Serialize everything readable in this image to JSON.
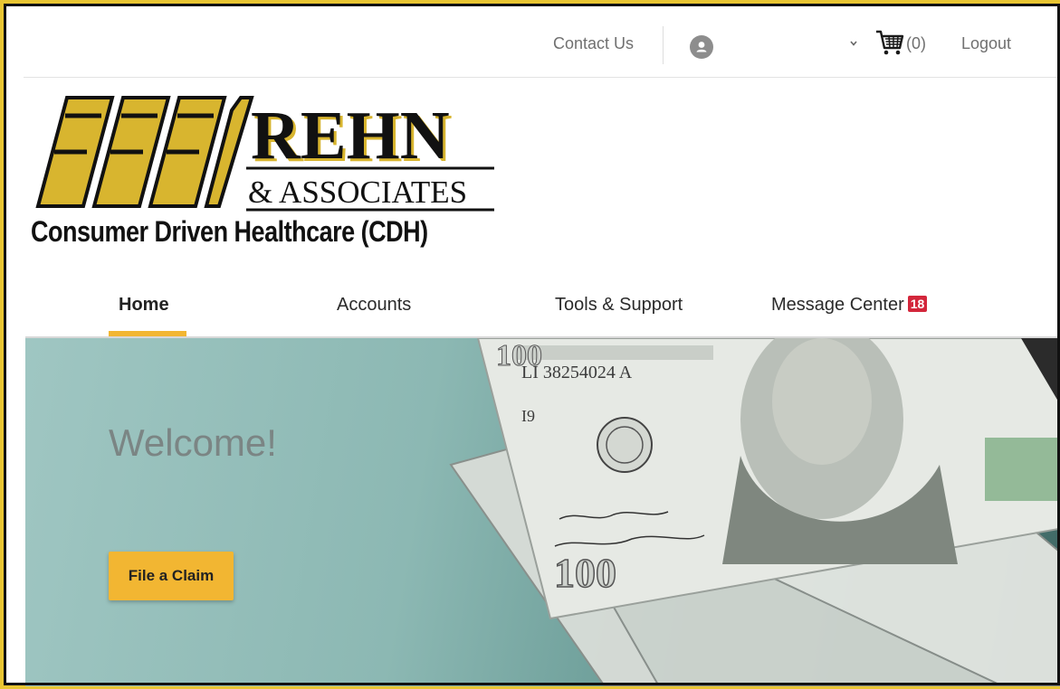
{
  "header": {
    "contact_label": "Contact Us",
    "cart_count": "(0)",
    "logout_label": "Logout"
  },
  "logo": {
    "brand": "REHN",
    "associates": "& ASSOCIATES",
    "tagline": "Consumer Driven Healthcare (CDH)"
  },
  "nav": {
    "items": [
      {
        "label": "Home"
      },
      {
        "label": "Accounts"
      },
      {
        "label": "Tools & Support"
      },
      {
        "label": "Message Center"
      }
    ],
    "message_badge": "18"
  },
  "hero": {
    "welcome": "Welcome!",
    "claim_button": "File a Claim"
  },
  "colors": {
    "accent": "#f2b632",
    "logo_gold": "#d8b52f",
    "badge": "#d3263b"
  }
}
